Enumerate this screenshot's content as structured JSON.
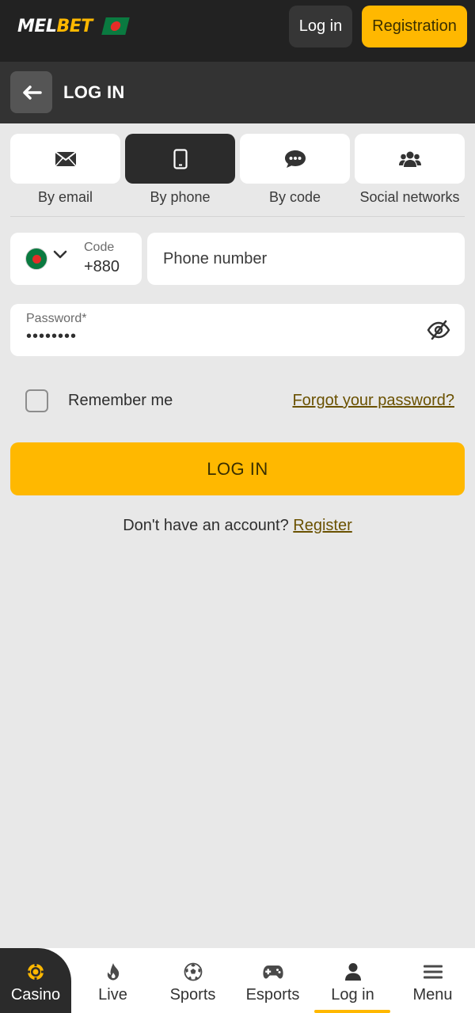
{
  "header": {
    "logo_part1": "MEL",
    "logo_part2": "BET",
    "login_label": "Log in",
    "register_label": "Registration"
  },
  "title_bar": {
    "title": "LOG IN"
  },
  "tabs": [
    {
      "label": "By email",
      "icon": "envelope-icon",
      "active": false
    },
    {
      "label": "By phone",
      "icon": "mobile-phone-icon",
      "active": true
    },
    {
      "label": "By code",
      "icon": "chat-bubble-icon",
      "active": false
    },
    {
      "label": "Social networks",
      "icon": "users-icon",
      "active": false
    }
  ],
  "phone": {
    "code_label": "Code",
    "code_value": "+880",
    "placeholder": "Phone number"
  },
  "password": {
    "label": "Password*",
    "value": "••••••••"
  },
  "remember_me": {
    "label": "Remember me",
    "checked": false
  },
  "forgot_password": "Forgot your password?",
  "login_button": "LOG IN",
  "signup": {
    "prompt": "Don't have an account?",
    "link": "Register"
  },
  "bottom_nav": [
    {
      "label": "Casino",
      "icon": "casino-chip-icon"
    },
    {
      "label": "Live",
      "icon": "flame-icon"
    },
    {
      "label": "Sports",
      "icon": "soccer-ball-icon"
    },
    {
      "label": "Esports",
      "icon": "gamepad-icon"
    },
    {
      "label": "Log in",
      "icon": "user-icon",
      "active": true
    },
    {
      "label": "Menu",
      "icon": "hamburger-menu-icon"
    }
  ],
  "colors": {
    "accent": "#ffb800",
    "header_bg": "#222222",
    "titlebar_bg": "#333333",
    "page_bg": "#e8e8e8",
    "link": "#6a5100"
  }
}
